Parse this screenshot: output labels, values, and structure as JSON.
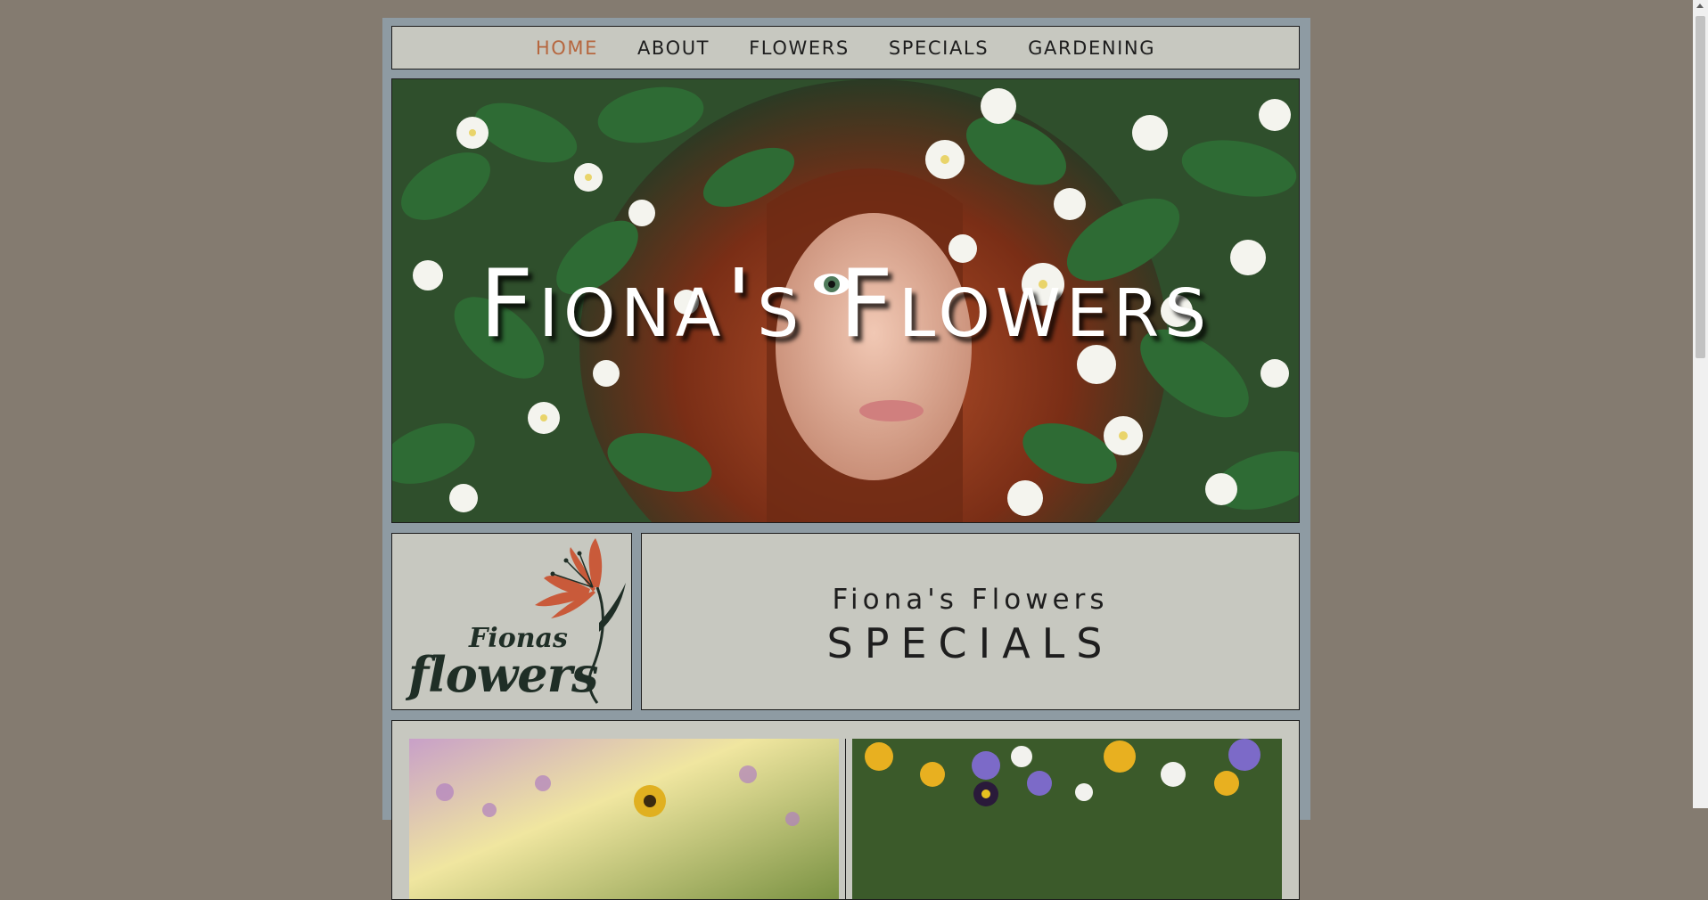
{
  "nav": {
    "items": [
      {
        "label": "HOME",
        "active": true
      },
      {
        "label": "ABOUT",
        "active": false
      },
      {
        "label": "FLOWERS",
        "active": false
      },
      {
        "label": "SPECIALS",
        "active": false
      },
      {
        "label": "GARDENING",
        "active": false
      }
    ]
  },
  "hero": {
    "title": "Fiona's Flowers"
  },
  "logo": {
    "line1": "Fionas",
    "line2": "flowers"
  },
  "specials": {
    "subtitle": "Fiona's Flowers",
    "title": "SPECIALS"
  },
  "colors": {
    "background": "#847b70",
    "panel": "#c7c8c0",
    "frame": "#8e9ba3",
    "accent": "#b6673f"
  }
}
